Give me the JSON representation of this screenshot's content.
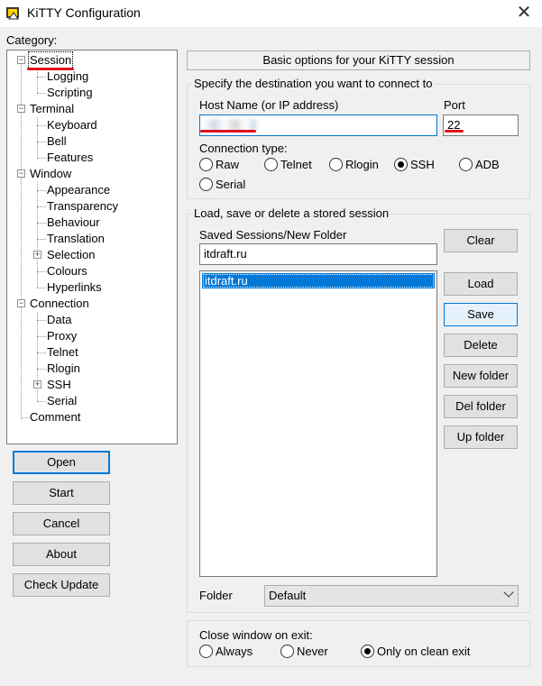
{
  "window": {
    "title": "KiTTY Configuration",
    "close_glyph": "✕"
  },
  "category": {
    "label": "Category:",
    "tree": {
      "session": "Session",
      "logging": "Logging",
      "scripting": "Scripting",
      "terminal": "Terminal",
      "keyboard": "Keyboard",
      "bell": "Bell",
      "features": "Features",
      "window": "Window",
      "appearance": "Appearance",
      "transparency": "Transparency",
      "behaviour": "Behaviour",
      "translation": "Translation",
      "selection": "Selection",
      "colours": "Colours",
      "hyperlinks": "Hyperlinks",
      "connection": "Connection",
      "data": "Data",
      "proxy": "Proxy",
      "telnet": "Telnet",
      "rlogin": "Rlogin",
      "ssh": "SSH",
      "serial": "Serial",
      "comment": "Comment"
    },
    "expander_minus": "−",
    "expander_plus": "+"
  },
  "left_buttons": {
    "open": "Open",
    "start": "Start",
    "cancel": "Cancel",
    "about": "About",
    "check_update": "Check Update"
  },
  "panel": {
    "header": "Basic options for your KiTTY session",
    "destination": {
      "group_title": "Specify the destination you want to connect to",
      "host_label": "Host Name (or IP address)",
      "host_value": "",
      "port_label": "Port",
      "port_value": "22",
      "conn_type_label": "Connection type:",
      "conn_types": [
        "Raw",
        "Telnet",
        "Rlogin",
        "SSH",
        "ADB",
        "Serial"
      ],
      "selected_conn_type": "SSH"
    },
    "sessions": {
      "group_title": "Load, save or delete a stored session",
      "saved_label": "Saved Sessions/New Folder",
      "saved_value": "itdraft.ru",
      "list_items": [
        "itdraft.ru"
      ],
      "buttons": {
        "clear": "Clear",
        "load": "Load",
        "save": "Save",
        "delete": "Delete",
        "new_folder": "New folder",
        "del_folder": "Del folder",
        "up_folder": "Up folder"
      },
      "folder_label": "Folder",
      "folder_value": "Default"
    },
    "close_window": {
      "label": "Close window on exit:",
      "options": [
        "Always",
        "Never",
        "Only on clean exit"
      ],
      "selected": "Only on clean exit"
    }
  },
  "colors": {
    "accent": "#0078d7",
    "annotation_red": "#e0121c"
  }
}
